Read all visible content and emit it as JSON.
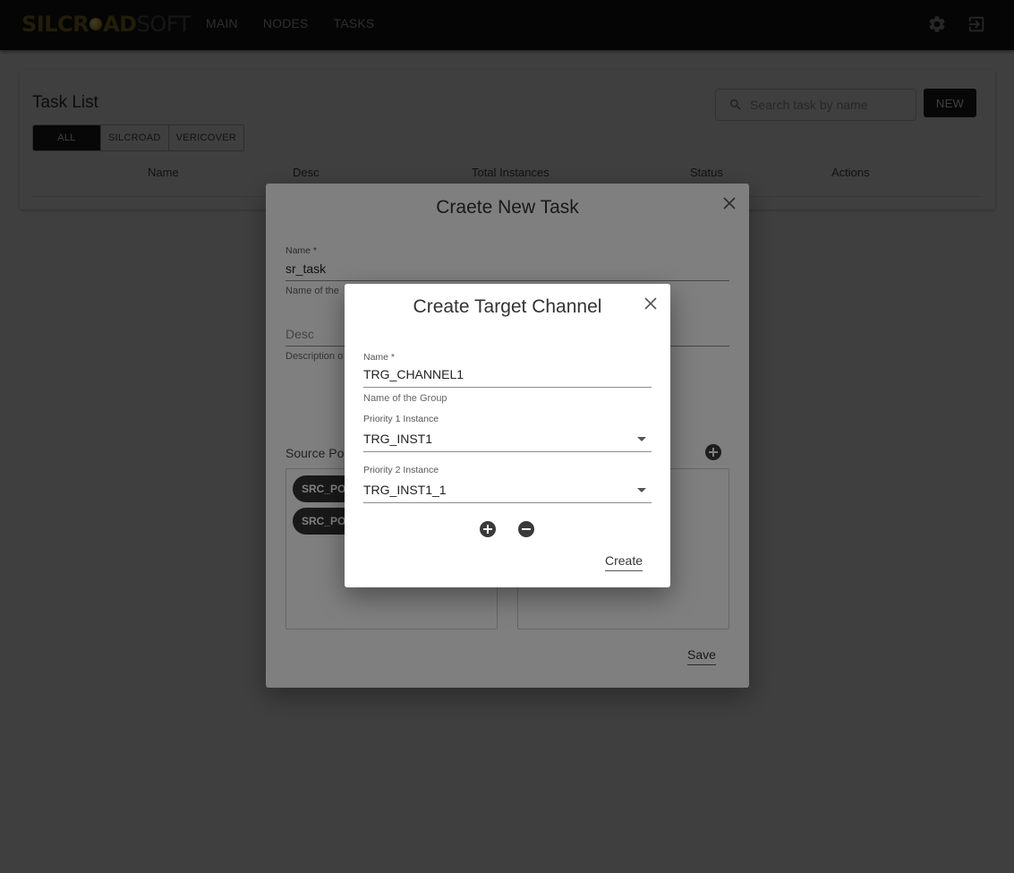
{
  "app": {
    "logo_part1": "SILCR",
    "logo_part2": "AD",
    "logo_part3": "SOFT",
    "nav": [
      "MAIN",
      "NODES",
      "TASKS"
    ],
    "icons": {
      "settings": "gear-icon",
      "logout": "logout-icon"
    }
  },
  "task_list": {
    "title": "Task List",
    "filters": [
      "ALL",
      "SILCROAD",
      "VERICOVER"
    ],
    "active_filter": "ALL",
    "search_placeholder": "Search task by name",
    "new_label": "NEW",
    "columns": [
      "Name",
      "Desc",
      "Total Instances",
      "Status",
      "Actions"
    ]
  },
  "create_task_dialog": {
    "title": "Craete New Task",
    "name_label": "Name *",
    "name_value": "sr_task",
    "name_helper": "Name of the",
    "desc_placeholder": "Desc",
    "desc_helper": "Description o",
    "source_label": "Source Po",
    "chips": [
      "SRC_PO",
      "SRC_PO"
    ],
    "save_label": "Save"
  },
  "create_target_dialog": {
    "title": "Create Target Channel",
    "name_label": "Name *",
    "name_value": "TRG_CHANNEL1",
    "name_helper": "Name of the Group",
    "priority1_label": "Priority 1 Instance",
    "priority1_value": "TRG_INST1",
    "priority2_label": "Priority 2 Instance",
    "priority2_value": "TRG_INST1_1",
    "create_label": "Create"
  }
}
